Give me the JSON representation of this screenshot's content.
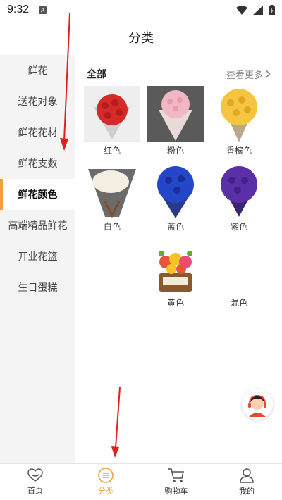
{
  "status_bar": {
    "time": "9:32",
    "notification_badge": "A"
  },
  "header": {
    "title": "分类"
  },
  "sidebar": {
    "items": [
      {
        "label": "鲜花",
        "active": false
      },
      {
        "label": "送花对象",
        "active": false
      },
      {
        "label": "鲜花花材",
        "active": false
      },
      {
        "label": "鲜花支数",
        "active": false
      },
      {
        "label": "鲜花颜色",
        "active": true
      },
      {
        "label": "高端精品鲜花",
        "active": false
      },
      {
        "label": "开业花篮",
        "active": false
      },
      {
        "label": "生日蛋糕",
        "active": false
      }
    ]
  },
  "content": {
    "section_title": "全部",
    "more_label": "查看更多",
    "items": [
      {
        "label": "红色",
        "flower_color": "#d42a2a"
      },
      {
        "label": "粉色",
        "flower_color": "#f2b7c4"
      },
      {
        "label": "香槟色",
        "flower_color": "#f5c542"
      },
      {
        "label": "白色",
        "flower_color": "#f4efe2"
      },
      {
        "label": "蓝色",
        "flower_color": "#2446c8"
      },
      {
        "label": "紫色",
        "flower_color": "#5b2fa8"
      },
      {
        "label": "黄色",
        "flower_color": "#f7c325"
      },
      {
        "label": "混色",
        "flower_color": "#e8553a"
      }
    ]
  },
  "tab_bar": {
    "tabs": [
      {
        "label": "首页",
        "icon": "heart-icon",
        "active": false
      },
      {
        "label": "分类",
        "icon": "category-icon",
        "active": true
      },
      {
        "label": "购物车",
        "icon": "cart-icon",
        "active": false
      },
      {
        "label": "我的",
        "icon": "user-icon",
        "active": false
      }
    ]
  },
  "colors": {
    "accent": "#f0a03c",
    "sidebar_bg": "#f4f4f4",
    "annotation_arrow": "#e02020"
  }
}
